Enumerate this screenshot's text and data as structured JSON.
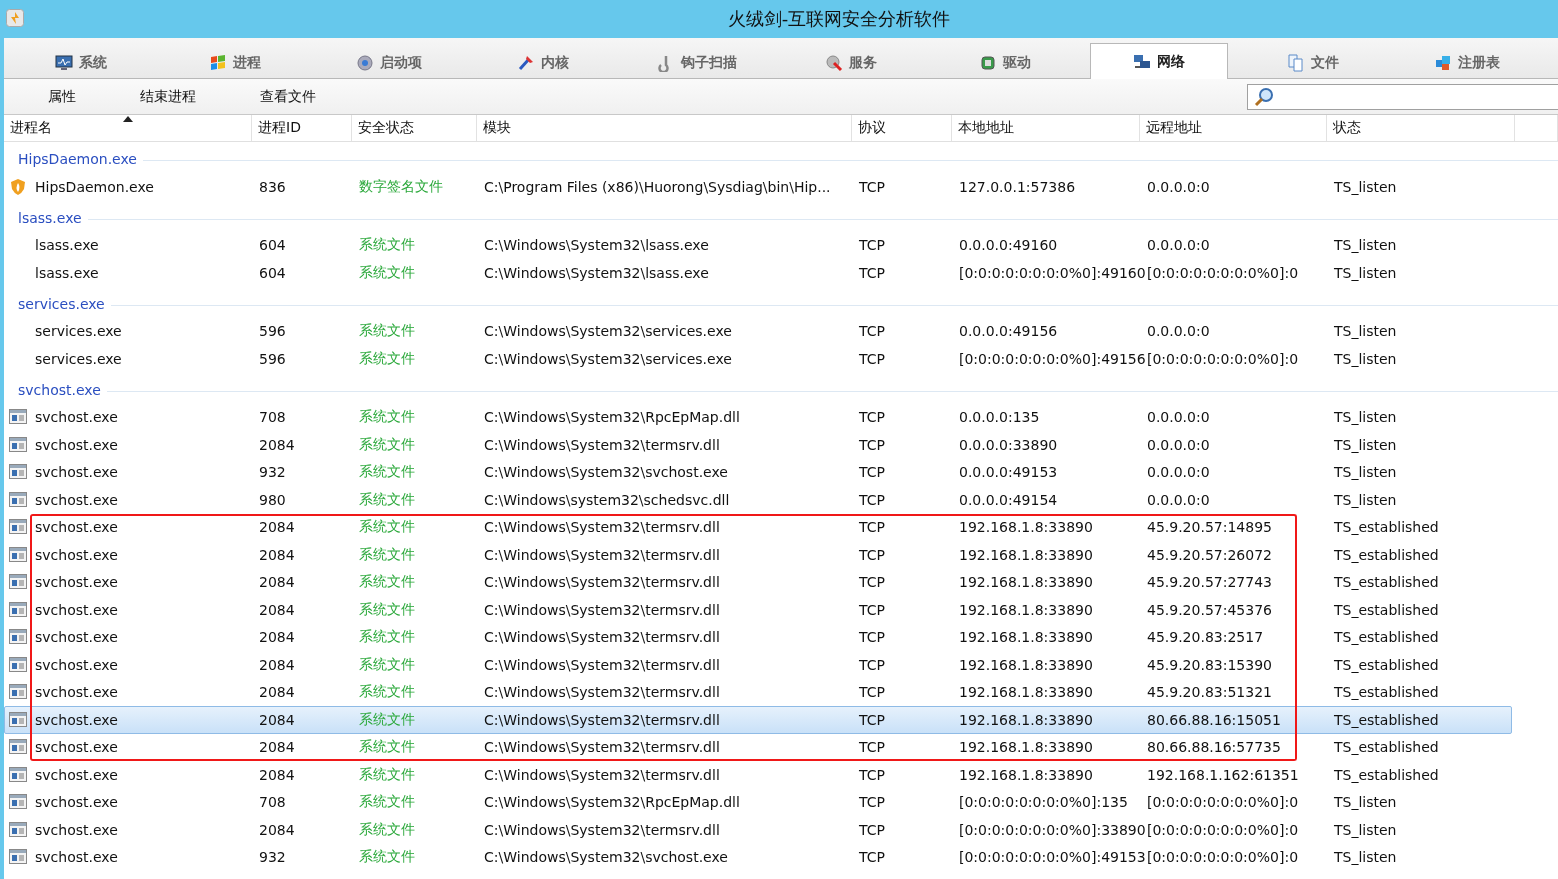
{
  "window": {
    "title": "火绒剑-互联网安全分析软件"
  },
  "tabs": [
    {
      "label": "系统",
      "selected": false
    },
    {
      "label": "进程",
      "selected": false
    },
    {
      "label": "启动项",
      "selected": false
    },
    {
      "label": "内核",
      "selected": false
    },
    {
      "label": "钩子扫描",
      "selected": false
    },
    {
      "label": "服务",
      "selected": false
    },
    {
      "label": "驱动",
      "selected": false
    },
    {
      "label": "网络",
      "selected": true
    },
    {
      "label": "文件",
      "selected": false
    },
    {
      "label": "注册表",
      "selected": false
    }
  ],
  "toolbar": {
    "buttons": [
      "属性",
      "结束进程",
      "查看文件"
    ]
  },
  "table": {
    "columns": [
      {
        "label": "进程名",
        "sorted": true
      },
      {
        "label": "进程ID",
        "sorted": false
      },
      {
        "label": "安全状态",
        "sorted": false
      },
      {
        "label": "模块",
        "sorted": false
      },
      {
        "label": "协议",
        "sorted": false
      },
      {
        "label": "本地地址",
        "sorted": false
      },
      {
        "label": "远程地址",
        "sorted": false
      },
      {
        "label": "状态",
        "sorted": false
      }
    ],
    "groups": [
      {
        "name": "HipsDaemon.exe",
        "rows": [
          {
            "kind": "shield",
            "selected": false,
            "boxed": false,
            "cells": [
              "HipsDaemon.exe",
              "836",
              "数字签名文件",
              "C:\\Program Files (x86)\\Huorong\\Sysdiag\\bin\\Hip...",
              "TCP",
              "127.0.0.1:57386",
              "0.0.0.0:0",
              "TS_listen"
            ]
          }
        ]
      },
      {
        "name": "lsass.exe",
        "rows": [
          {
            "kind": "plain",
            "selected": false,
            "boxed": false,
            "cells": [
              "lsass.exe",
              "604",
              "系统文件",
              "C:\\Windows\\System32\\lsass.exe",
              "TCP",
              "0.0.0.0:49160",
              "0.0.0.0:0",
              "TS_listen"
            ]
          },
          {
            "kind": "plain",
            "selected": false,
            "boxed": false,
            "cells": [
              "lsass.exe",
              "604",
              "系统文件",
              "C:\\Windows\\System32\\lsass.exe",
              "TCP",
              "[0:0:0:0:0:0:0:0%0]:49160",
              "[0:0:0:0:0:0:0:0%0]:0",
              "TS_listen"
            ]
          }
        ]
      },
      {
        "name": "services.exe",
        "rows": [
          {
            "kind": "plain",
            "selected": false,
            "boxed": false,
            "cells": [
              "services.exe",
              "596",
              "系统文件",
              "C:\\Windows\\System32\\services.exe",
              "TCP",
              "0.0.0.0:49156",
              "0.0.0.0:0",
              "TS_listen"
            ]
          },
          {
            "kind": "plain",
            "selected": false,
            "boxed": false,
            "cells": [
              "services.exe",
              "596",
              "系统文件",
              "C:\\Windows\\System32\\services.exe",
              "TCP",
              "[0:0:0:0:0:0:0:0%0]:49156",
              "[0:0:0:0:0:0:0:0%0]:0",
              "TS_listen"
            ]
          }
        ]
      },
      {
        "name": "svchost.exe",
        "rows": [
          {
            "kind": "window",
            "selected": false,
            "boxed": false,
            "cells": [
              "svchost.exe",
              "708",
              "系统文件",
              "C:\\Windows\\System32\\RpcEpMap.dll",
              "TCP",
              "0.0.0.0:135",
              "0.0.0.0:0",
              "TS_listen"
            ]
          },
          {
            "kind": "window",
            "selected": false,
            "boxed": false,
            "cells": [
              "svchost.exe",
              "2084",
              "系统文件",
              "C:\\Windows\\System32\\termsrv.dll",
              "TCP",
              "0.0.0.0:33890",
              "0.0.0.0:0",
              "TS_listen"
            ]
          },
          {
            "kind": "window",
            "selected": false,
            "boxed": false,
            "cells": [
              "svchost.exe",
              "932",
              "系统文件",
              "C:\\Windows\\System32\\svchost.exe",
              "TCP",
              "0.0.0.0:49153",
              "0.0.0.0:0",
              "TS_listen"
            ]
          },
          {
            "kind": "window",
            "selected": false,
            "boxed": false,
            "cells": [
              "svchost.exe",
              "980",
              "系统文件",
              "C:\\Windows\\system32\\schedsvc.dll",
              "TCP",
              "0.0.0.0:49154",
              "0.0.0.0:0",
              "TS_listen"
            ]
          },
          {
            "kind": "window",
            "selected": false,
            "boxed": true,
            "cells": [
              "svchost.exe",
              "2084",
              "系统文件",
              "C:\\Windows\\System32\\termsrv.dll",
              "TCP",
              "192.168.1.8:33890",
              "45.9.20.57:14895",
              "TS_established"
            ]
          },
          {
            "kind": "window",
            "selected": false,
            "boxed": true,
            "cells": [
              "svchost.exe",
              "2084",
              "系统文件",
              "C:\\Windows\\System32\\termsrv.dll",
              "TCP",
              "192.168.1.8:33890",
              "45.9.20.57:26072",
              "TS_established"
            ]
          },
          {
            "kind": "window",
            "selected": false,
            "boxed": true,
            "cells": [
              "svchost.exe",
              "2084",
              "系统文件",
              "C:\\Windows\\System32\\termsrv.dll",
              "TCP",
              "192.168.1.8:33890",
              "45.9.20.57:27743",
              "TS_established"
            ]
          },
          {
            "kind": "window",
            "selected": false,
            "boxed": true,
            "cells": [
              "svchost.exe",
              "2084",
              "系统文件",
              "C:\\Windows\\System32\\termsrv.dll",
              "TCP",
              "192.168.1.8:33890",
              "45.9.20.57:45376",
              "TS_established"
            ]
          },
          {
            "kind": "window",
            "selected": false,
            "boxed": true,
            "cells": [
              "svchost.exe",
              "2084",
              "系统文件",
              "C:\\Windows\\System32\\termsrv.dll",
              "TCP",
              "192.168.1.8:33890",
              "45.9.20.83:2517",
              "TS_established"
            ]
          },
          {
            "kind": "window",
            "selected": false,
            "boxed": true,
            "cells": [
              "svchost.exe",
              "2084",
              "系统文件",
              "C:\\Windows\\System32\\termsrv.dll",
              "TCP",
              "192.168.1.8:33890",
              "45.9.20.83:15390",
              "TS_established"
            ]
          },
          {
            "kind": "window",
            "selected": false,
            "boxed": true,
            "cells": [
              "svchost.exe",
              "2084",
              "系统文件",
              "C:\\Windows\\System32\\termsrv.dll",
              "TCP",
              "192.168.1.8:33890",
              "45.9.20.83:51321",
              "TS_established"
            ]
          },
          {
            "kind": "window",
            "selected": true,
            "boxed": true,
            "cells": [
              "svchost.exe",
              "2084",
              "系统文件",
              "C:\\Windows\\System32\\termsrv.dll",
              "TCP",
              "192.168.1.8:33890",
              "80.66.88.16:15051",
              "TS_established"
            ]
          },
          {
            "kind": "window",
            "selected": false,
            "boxed": true,
            "cells": [
              "svchost.exe",
              "2084",
              "系统文件",
              "C:\\Windows\\System32\\termsrv.dll",
              "TCP",
              "192.168.1.8:33890",
              "80.66.88.16:57735",
              "TS_established"
            ]
          },
          {
            "kind": "window",
            "selected": false,
            "boxed": false,
            "cells": [
              "svchost.exe",
              "2084",
              "系统文件",
              "C:\\Windows\\System32\\termsrv.dll",
              "TCP",
              "192.168.1.8:33890",
              "192.168.1.162:61351",
              "TS_established"
            ]
          },
          {
            "kind": "window",
            "selected": false,
            "boxed": false,
            "cells": [
              "svchost.exe",
              "708",
              "系统文件",
              "C:\\Windows\\System32\\RpcEpMap.dll",
              "TCP",
              "[0:0:0:0:0:0:0:0%0]:135",
              "[0:0:0:0:0:0:0:0%0]:0",
              "TS_listen"
            ]
          },
          {
            "kind": "window",
            "selected": false,
            "boxed": false,
            "cells": [
              "svchost.exe",
              "2084",
              "系统文件",
              "C:\\Windows\\System32\\termsrv.dll",
              "TCP",
              "[0:0:0:0:0:0:0:0%0]:33890",
              "[0:0:0:0:0:0:0:0%0]:0",
              "TS_listen"
            ]
          },
          {
            "kind": "window",
            "selected": false,
            "boxed": false,
            "cells": [
              "svchost.exe",
              "932",
              "系统文件",
              "C:\\Windows\\System32\\svchost.exe",
              "TCP",
              "[0:0:0:0:0:0:0:0%0]:49153",
              "[0:0:0:0:0:0:0:0%0]:0",
              "TS_listen"
            ]
          }
        ]
      }
    ]
  }
}
